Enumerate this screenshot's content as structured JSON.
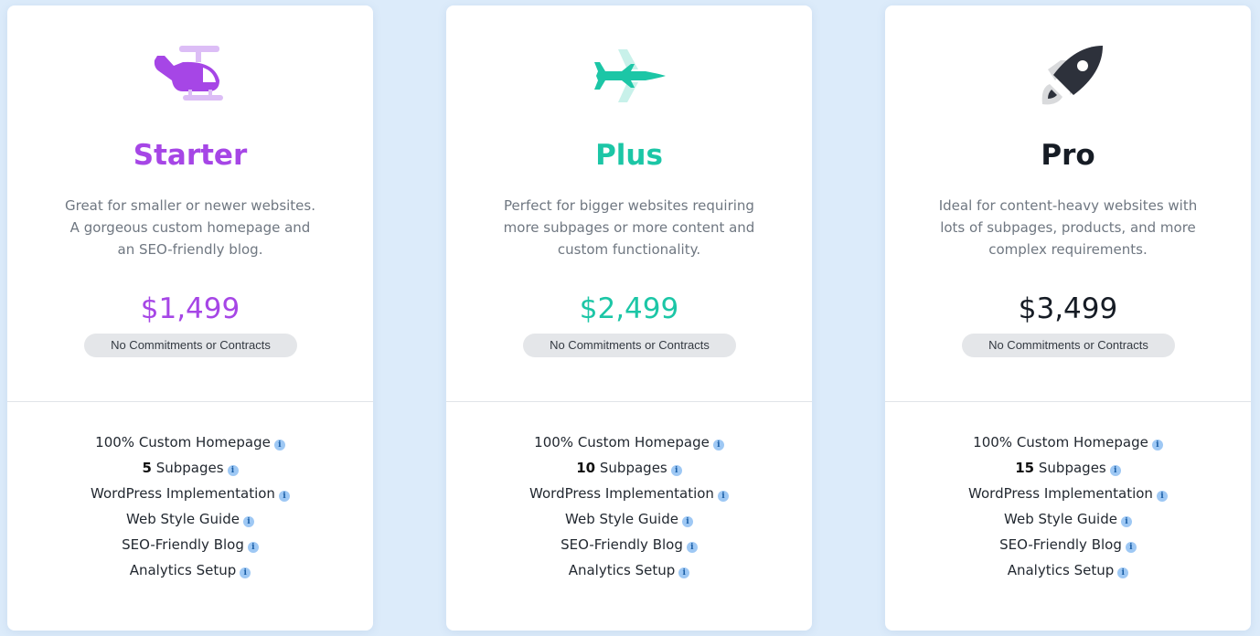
{
  "colors": {
    "starter": "#a646e6",
    "plus": "#1cc6a6",
    "pro": "#161c25",
    "info_icon": "#9ec8f4"
  },
  "plans": [
    {
      "icon": "helicopter-icon",
      "title": "Starter",
      "description": "Great for smaller or newer websites. A gorgeous custom homepage and an SEO-friendly blog.",
      "price": "$1,499",
      "badge": "No Commitments or Contracts",
      "features": {
        "homepage": "100% Custom Homepage",
        "subpages_count": "5",
        "subpages_label": "Subpages",
        "wordpress": "WordPress Implementation",
        "style_guide": "Web Style Guide",
        "blog": "SEO-Friendly Blog",
        "analytics": "Analytics Setup"
      }
    },
    {
      "icon": "fighter-jet-icon",
      "title": "Plus",
      "description": "Perfect for bigger websites requiring more subpages or more content and custom functionality.",
      "price": "$2,499",
      "badge": "No Commitments or Contracts",
      "features": {
        "homepage": "100% Custom Homepage",
        "subpages_count": "10",
        "subpages_label": "Subpages",
        "wordpress": "WordPress Implementation",
        "style_guide": "Web Style Guide",
        "blog": "SEO-Friendly Blog",
        "analytics": "Analytics Setup"
      }
    },
    {
      "icon": "rocket-icon",
      "title": "Pro",
      "description": "Ideal for content-heavy websites with lots of subpages, products, and more complex requirements.",
      "price": "$3,499",
      "badge": "No Commitments or Contracts",
      "features": {
        "homepage": "100% Custom Homepage",
        "subpages_count": "15",
        "subpages_label": "Subpages",
        "wordpress": "WordPress Implementation",
        "style_guide": "Web Style Guide",
        "blog": "SEO-Friendly Blog",
        "analytics": "Analytics Setup"
      }
    }
  ]
}
